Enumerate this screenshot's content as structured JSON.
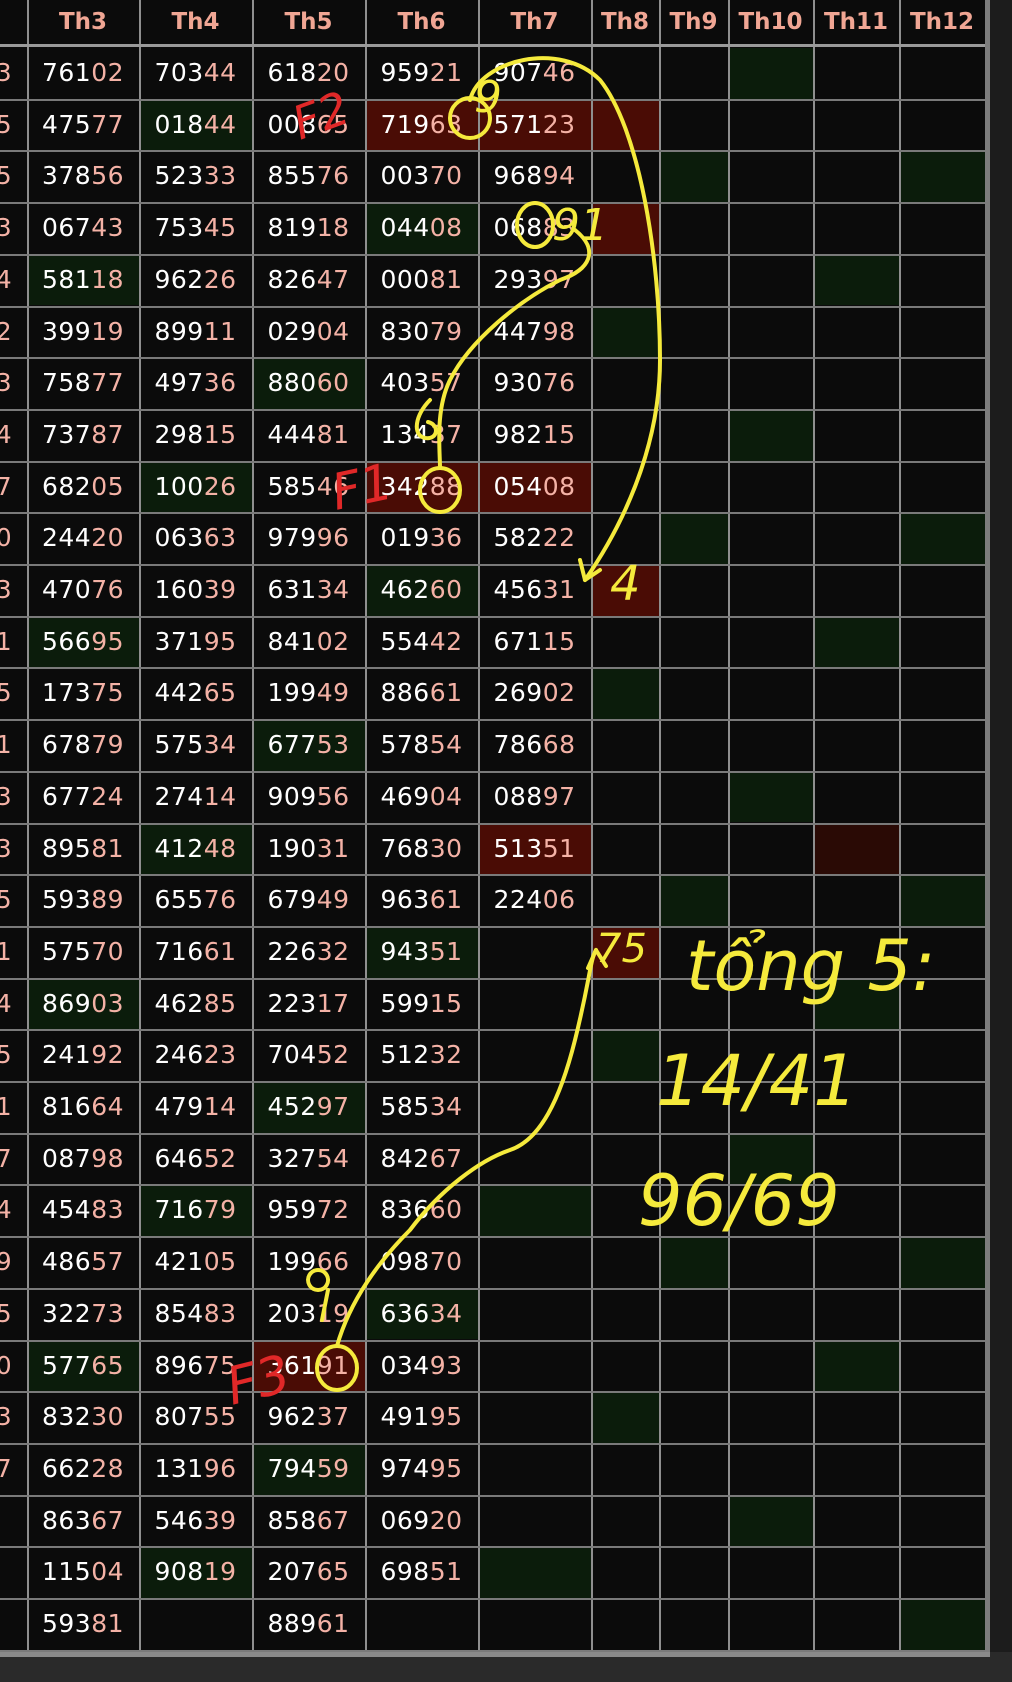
{
  "headers": [
    "",
    "Th3",
    "Th4",
    "Th5",
    "Th6",
    "Th7",
    "Th8",
    "Th9",
    "Th10",
    "Th11",
    "Th12"
  ],
  "left_digits": [
    "3",
    "5",
    "5",
    "3",
    "4",
    "2",
    "3",
    "4",
    "7",
    "0",
    "3",
    "1",
    "5",
    "1",
    "3",
    "3",
    "5",
    "1",
    "4",
    "5",
    "1",
    "7",
    "4",
    "9",
    "5",
    "0",
    "3",
    "7",
    "",
    "",
    ""
  ],
  "rows": [
    [
      "76102",
      "70344",
      "61820",
      "95921",
      "90746"
    ],
    [
      "47577",
      "01844",
      "00865",
      "71963",
      "57123"
    ],
    [
      "37856",
      "52333",
      "85576",
      "00370",
      "96894"
    ],
    [
      "06743",
      "75345",
      "81918",
      "04408",
      "06883"
    ],
    [
      "58118",
      "96226",
      "82647",
      "00081",
      "29397"
    ],
    [
      "39919",
      "89911",
      "02904",
      "83079",
      "44798"
    ],
    [
      "75877",
      "49736",
      "88060",
      "40357",
      "93076"
    ],
    [
      "73787",
      "29815",
      "44481",
      "13437",
      "98215"
    ],
    [
      "68205",
      "10026",
      "58546",
      "34288",
      "05408"
    ],
    [
      "24420",
      "06363",
      "97996",
      "01936",
      "58222"
    ],
    [
      "47076",
      "16039",
      "63134",
      "46260",
      "45631"
    ],
    [
      "56695",
      "37195",
      "84102",
      "55442",
      "67115"
    ],
    [
      "17375",
      "44265",
      "19949",
      "88661",
      "26902"
    ],
    [
      "67879",
      "57534",
      "67753",
      "57854",
      "78668"
    ],
    [
      "67724",
      "27414",
      "90956",
      "46904",
      "08897"
    ],
    [
      "89581",
      "41248",
      "19031",
      "76830",
      "51351"
    ],
    [
      "59389",
      "65576",
      "67949",
      "96361",
      "22406"
    ],
    [
      "57570",
      "71661",
      "22632",
      "94351",
      ""
    ],
    [
      "86903",
      "46285",
      "22317",
      "59915",
      ""
    ],
    [
      "24192",
      "24623",
      "70452",
      "51232",
      ""
    ],
    [
      "81664",
      "47914",
      "45297",
      "58534",
      ""
    ],
    [
      "08798",
      "64652",
      "32754",
      "84267",
      ""
    ],
    [
      "45483",
      "71679",
      "95972",
      "83660",
      ""
    ],
    [
      "48657",
      "42105",
      "19966",
      "09870",
      ""
    ],
    [
      "32273",
      "85483",
      "20319",
      "63634",
      ""
    ],
    [
      "57765",
      "89675",
      "36191",
      "03493",
      ""
    ],
    [
      "83230",
      "80755",
      "96237",
      "49195",
      ""
    ],
    [
      "66228",
      "13196",
      "79459",
      "97495",
      ""
    ],
    [
      "86367",
      "54639",
      "85867",
      "06920",
      ""
    ],
    [
      "11504",
      "90819",
      "20765",
      "69851",
      ""
    ],
    [
      "59381",
      "",
      "88961",
      "",
      ""
    ]
  ],
  "colors": {
    "background": "#0b0b0b",
    "header_text": "#f0a694",
    "digit_white": "#ffffff",
    "digit_pink": "#f4b2a6",
    "highlight_red": "#4a0c05",
    "highlight_dark_red": "#2a0a05",
    "highlight_green": "#0b1c0b",
    "annotation_yellow": "#f5ea3c",
    "annotation_red": "#e02828"
  },
  "highlights": [
    {
      "row": 0,
      "col": 8,
      "kind": "green"
    },
    {
      "row": 1,
      "col": 4,
      "kind": "red"
    },
    {
      "row": 1,
      "col": 5,
      "kind": "red"
    },
    {
      "row": 1,
      "col": 6,
      "kind": "red"
    },
    {
      "row": 1,
      "col": 2,
      "kind": "green"
    },
    {
      "row": 2,
      "col": 7,
      "kind": "green"
    },
    {
      "row": 2,
      "col": 10,
      "kind": "green"
    },
    {
      "row": 3,
      "col": 6,
      "kind": "red"
    },
    {
      "row": 3,
      "col": 4,
      "kind": "green"
    },
    {
      "row": 4,
      "col": 1,
      "kind": "green"
    },
    {
      "row": 4,
      "col": 9,
      "kind": "green"
    },
    {
      "row": 5,
      "col": 6,
      "kind": "green"
    },
    {
      "row": 6,
      "col": 3,
      "kind": "green"
    },
    {
      "row": 7,
      "col": 8,
      "kind": "green"
    },
    {
      "row": 8,
      "col": 4,
      "kind": "red"
    },
    {
      "row": 8,
      "col": 5,
      "kind": "red"
    },
    {
      "row": 8,
      "col": 2,
      "kind": "green"
    },
    {
      "row": 9,
      "col": 7,
      "kind": "green"
    },
    {
      "row": 9,
      "col": 10,
      "kind": "green"
    },
    {
      "row": 10,
      "col": 6,
      "kind": "red"
    },
    {
      "row": 10,
      "col": 4,
      "kind": "green"
    },
    {
      "row": 11,
      "col": 1,
      "kind": "green"
    },
    {
      "row": 11,
      "col": 9,
      "kind": "green"
    },
    {
      "row": 12,
      "col": 6,
      "kind": "green"
    },
    {
      "row": 13,
      "col": 3,
      "kind": "green"
    },
    {
      "row": 14,
      "col": 8,
      "kind": "green"
    },
    {
      "row": 15,
      "col": 5,
      "kind": "red"
    },
    {
      "row": 15,
      "col": 9,
      "kind": "darkred"
    },
    {
      "row": 15,
      "col": 2,
      "kind": "green"
    },
    {
      "row": 16,
      "col": 7,
      "kind": "green"
    },
    {
      "row": 16,
      "col": 10,
      "kind": "green"
    },
    {
      "row": 17,
      "col": 6,
      "kind": "red"
    },
    {
      "row": 17,
      "col": 4,
      "kind": "green"
    },
    {
      "row": 18,
      "col": 1,
      "kind": "green"
    },
    {
      "row": 18,
      "col": 9,
      "kind": "green"
    },
    {
      "row": 19,
      "col": 6,
      "kind": "green"
    },
    {
      "row": 20,
      "col": 3,
      "kind": "green"
    },
    {
      "row": 21,
      "col": 8,
      "kind": "green"
    },
    {
      "row": 22,
      "col": 5,
      "kind": "green"
    },
    {
      "row": 22,
      "col": 2,
      "kind": "green"
    },
    {
      "row": 23,
      "col": 7,
      "kind": "green"
    },
    {
      "row": 23,
      "col": 10,
      "kind": "green"
    },
    {
      "row": 24,
      "col": 4,
      "kind": "green"
    },
    {
      "row": 25,
      "col": 3,
      "kind": "red"
    },
    {
      "row": 25,
      "col": 1,
      "kind": "green"
    },
    {
      "row": 25,
      "col": 9,
      "kind": "green"
    },
    {
      "row": 26,
      "col": 6,
      "kind": "green"
    },
    {
      "row": 27,
      "col": 3,
      "kind": "green"
    },
    {
      "row": 28,
      "col": 8,
      "kind": "green"
    },
    {
      "row": 29,
      "col": 5,
      "kind": "green"
    },
    {
      "row": 29,
      "col": 2,
      "kind": "green"
    },
    {
      "row": 30,
      "col": 10,
      "kind": "green"
    }
  ],
  "annotations": {
    "note_line1": "tổng 5:",
    "note_line2": "14/41",
    "note_line3": "96/69",
    "mark_4": "4",
    "mark_75": "75",
    "mark_91": "91",
    "mark_9_th6": "9",
    "mark_9_bottom": "9",
    "mark_6": "6",
    "mark_f1": "F1",
    "mark_f2": "F2",
    "mark_f3": "F3"
  }
}
